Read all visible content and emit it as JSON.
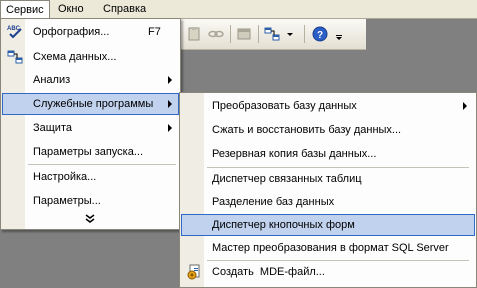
{
  "menubar": {
    "items": [
      {
        "label": "Сервис",
        "open": true
      },
      {
        "label": "Окно"
      },
      {
        "label": "Справка"
      }
    ]
  },
  "toolbar": {
    "icons": [
      "paste-icon",
      "link-icon",
      "properties-icon",
      "relationships-icon",
      "help-icon"
    ]
  },
  "service_menu": {
    "items": [
      {
        "label": "Орфография...",
        "shortcut": "F7",
        "icon": "spelling-abc-icon"
      },
      {
        "label": "Схема данных...",
        "icon": "relationships-icon"
      },
      {
        "label": "Анализ",
        "submenu": true
      },
      {
        "label": "Служебные программы",
        "submenu": true,
        "highlighted": true
      },
      {
        "label": "Защита",
        "submenu": true
      },
      {
        "label": "Параметры запуска..."
      },
      {
        "label": "Настройка..."
      },
      {
        "label": "Параметры..."
      }
    ],
    "expand_icon": "chevron-double-down-icon"
  },
  "utilities_menu": {
    "items": [
      {
        "label": "Преобразовать базу данных",
        "submenu": true
      },
      {
        "label": "Сжать и восстановить базу данных..."
      },
      {
        "label": "Резервная копия базы данных..."
      },
      {
        "label": "Диспетчер связанных таблиц"
      },
      {
        "label": "Разделение баз данных"
      },
      {
        "label": "Диспетчер кнопочных форм",
        "highlighted": true
      },
      {
        "label": "Мастер преобразования в формат SQL Server"
      },
      {
        "label": "Создать  MDE-файл...",
        "icon": "mde-file-icon"
      }
    ]
  },
  "colors": {
    "highlight_fill": "#c1d2ee",
    "highlight_border": "#316ac5",
    "menubar_bg": "#ece9d8",
    "desktop_gray": "#808080"
  }
}
